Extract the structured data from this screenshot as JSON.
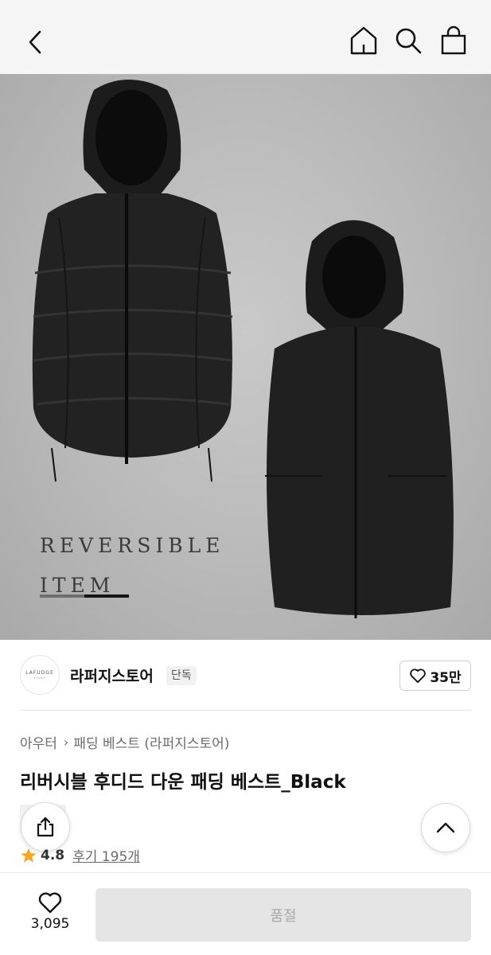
{
  "header": {
    "icons": [
      "back-arrow-icon",
      "home-icon",
      "search-icon",
      "shopping-bag-icon"
    ]
  },
  "hero": {
    "line1": "REVERSIBLE",
    "line2": "ITEM"
  },
  "brand": {
    "logo_text": "LAFUDGE",
    "logo_subtext": "STORE",
    "name": "라퍼지스토어",
    "badge": "단독",
    "like_count": "35만"
  },
  "breadcrumb": {
    "category": "아우터",
    "subcategory": "패딩 베스트 (라퍼지스토어)"
  },
  "product": {
    "title": "리버시블 후디드 다운 패딩 베스트_Black",
    "rating": "4.8",
    "reviews": "후기 195개"
  },
  "bottom_bar": {
    "wish_count": "3,095",
    "soldout_label": "품절"
  },
  "colors": {
    "star": "#f5a623",
    "disabled_button": "#e5e5e5"
  }
}
